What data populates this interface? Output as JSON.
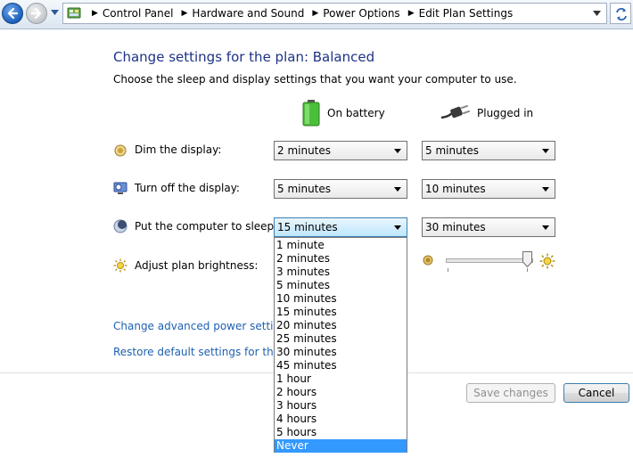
{
  "address_bar": {
    "breadcrumbs": [
      "Control Panel",
      "Hardware and Sound",
      "Power Options",
      "Edit Plan Settings"
    ]
  },
  "page": {
    "title": "Change settings for the plan: Balanced",
    "subtitle": "Choose the sleep and display settings that you want your computer to use.",
    "columns": {
      "battery": "On battery",
      "plugged": "Plugged in"
    }
  },
  "settings": {
    "dim": {
      "label": "Dim the display:",
      "battery": "2 minutes",
      "plugged": "5 minutes"
    },
    "off": {
      "label": "Turn off the display:",
      "battery": "5 minutes",
      "plugged": "10 minutes"
    },
    "sleep": {
      "label": "Put the computer to sleep:",
      "battery": "15 minutes",
      "plugged": "30 minutes"
    },
    "brightness": {
      "label": "Adjust plan brightness:",
      "plugged_level": 1.0
    }
  },
  "dropdown": {
    "options": [
      "1 minute",
      "2 minutes",
      "3 minutes",
      "5 minutes",
      "10 minutes",
      "15 minutes",
      "20 minutes",
      "25 minutes",
      "30 minutes",
      "45 minutes",
      "1 hour",
      "2 hours",
      "3 hours",
      "4 hours",
      "5 hours",
      "Never"
    ],
    "highlighted": "Never"
  },
  "links": {
    "advanced": "Change advanced power settings",
    "restore": "Restore default settings for this pla"
  },
  "buttons": {
    "save": "Save changes",
    "cancel": "Cancel"
  },
  "colors": {
    "title": "#1e3287",
    "link": "#1e60b0",
    "highlight": "#3399ff"
  }
}
